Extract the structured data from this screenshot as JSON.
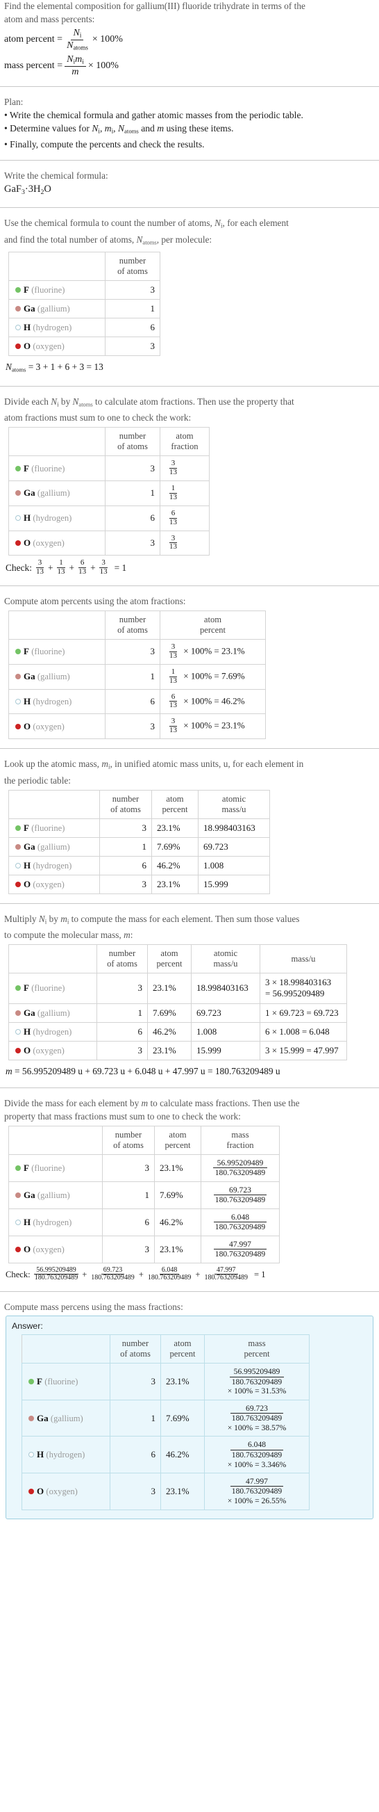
{
  "question": {
    "line1": "Find the elemental composition for gallium(III) fluoride trihydrate in terms of the",
    "line2": "atom and mass percents:",
    "atom_percent_label": "atom percent =",
    "mass_percent_label": "mass percent =",
    "percent_100": "× 100%"
  },
  "plan": {
    "title": "Plan:",
    "items": [
      "• Write the chemical formula and gather atomic masses from the periodic table.",
      "• Determine values for Ni, mi, Natoms and m using these items.",
      "• Finally, compute the percents and check the results."
    ],
    "bullet2_pre": "• Determine values for ",
    "bullet2_mid": " and ",
    "bullet2_post": " using these items."
  },
  "formula_section": {
    "prompt": "Write the chemical formula:",
    "formula": "GaF3·3H2O"
  },
  "count_section": {
    "prompt_line1": "Use the chemical formula to count the number of atoms, Ni, for each element",
    "prompt_line2": "and find the total number of atoms, Natoms, per molecule:",
    "headers": {
      "blank": "",
      "number_of_atoms": "number\nof atoms"
    },
    "total_line": "Natoms = 3 + 1 + 6 + 3 = 13",
    "total_expr": "= 3 + 1 + 6 + 3 = 13"
  },
  "fraction_section": {
    "prompt_line1": "Divide each Ni by Natoms to calculate atom fractions. Then use the property that",
    "prompt_line2": "atom fractions must sum to one to check the work:",
    "header_atom_fraction": "atom\nfraction",
    "check_label": "Check:",
    "check_result": "= 1"
  },
  "atom_percent_section": {
    "prompt": "Compute atom percents using the atom fractions:",
    "header_atom_percent": "atom\npercent"
  },
  "atomic_mass_section": {
    "prompt_line1": "Look up the atomic mass, mi, in unified atomic mass units, u, for each element in",
    "prompt_line2": "the periodic table:",
    "header_atomic_mass": "atomic\nmass/u"
  },
  "mass_section": {
    "prompt_line1": "Multiply Ni by mi to compute the mass for each element. Then sum those values",
    "prompt_line2": "to compute the molecular mass, m:",
    "header_mass": "mass/u",
    "molecular_mass_line": "m = 56.995209489 u + 69.723 u + 6.048 u + 47.997 u = 180.763209489 u",
    "molecular_mass_expr": "= 56.995209489 u + 69.723 u + 6.048 u + 47.997 u = 180.763209489 u"
  },
  "mass_fraction_section": {
    "prompt_line1": "Divide the mass for each element by m to calculate mass fractions. Then use the",
    "prompt_line2": "property that mass fractions must sum to one to check the work:",
    "header_mass_fraction": "mass\nfraction",
    "check_label": "Check:",
    "check_result": "= 1"
  },
  "mass_percent_section": {
    "prompt": "Compute mass percens using the mass fractions:",
    "answer_label": "Answer:",
    "header_mass_percent": "mass\npercent",
    "times_100": "× 100% ="
  },
  "headers": {
    "number_of_atoms_l1": "number",
    "number_of_atoms_l2": "of atoms",
    "atom_l1": "atom",
    "fraction_l2": "fraction",
    "percent_l2": "percent",
    "atomic_l1": "atomic",
    "mass_u_l2": "mass/u",
    "mass_u": "mass/u",
    "mass_l1": "mass",
    "mass_fraction_l2": "fraction",
    "mass_percent_l2": "percent"
  },
  "denominator": "180.763209489",
  "total_atoms": "13",
  "elements": [
    {
      "symbol": "F",
      "name": "(fluorine)",
      "color": "#74c365",
      "filled": true,
      "atoms": "3",
      "fraction_num": "3",
      "fraction_den": "13",
      "atom_percent": "23.1%",
      "atomic_mass": "18.998403163",
      "mass_expr": "3 × 18.998403163",
      "mass_expr_eq": "= 56.995209489",
      "mass_expr_oneline": "3 × 18.998403163 = 56.995209489",
      "mass_value": "56.995209489",
      "mass_percent": "31.53%"
    },
    {
      "symbol": "Ga",
      "name": "(gallium)",
      "color": "#c88a84",
      "filled": true,
      "atoms": "1",
      "fraction_num": "1",
      "fraction_den": "13",
      "atom_percent": "7.69%",
      "atomic_mass": "69.723",
      "mass_expr": "1 × 69.723 = 69.723",
      "mass_expr_eq": "",
      "mass_expr_oneline": "1 × 69.723 = 69.723",
      "mass_value": "69.723",
      "mass_percent": "38.57%"
    },
    {
      "symbol": "H",
      "name": "(hydrogen)",
      "color": "#ffffff",
      "filled": false,
      "atoms": "6",
      "fraction_num": "6",
      "fraction_den": "13",
      "atom_percent": "46.2%",
      "atomic_mass": "1.008",
      "mass_expr": "6 × 1.008 = 6.048",
      "mass_expr_eq": "",
      "mass_expr_oneline": "6 × 1.008 = 6.048",
      "mass_value": "6.048",
      "mass_percent": "3.346%"
    },
    {
      "symbol": "O",
      "name": "(oxygen)",
      "color": "#cc2222",
      "filled": true,
      "atoms": "3",
      "fraction_num": "3",
      "fraction_den": "13",
      "atom_percent": "23.1%",
      "atomic_mass": "15.999",
      "mass_expr": "3 × 15.999 = 47.997",
      "mass_expr_eq": "",
      "mass_expr_oneline": "3 × 15.999 = 47.997",
      "mass_value": "47.997",
      "mass_percent": "26.55%"
    }
  ]
}
